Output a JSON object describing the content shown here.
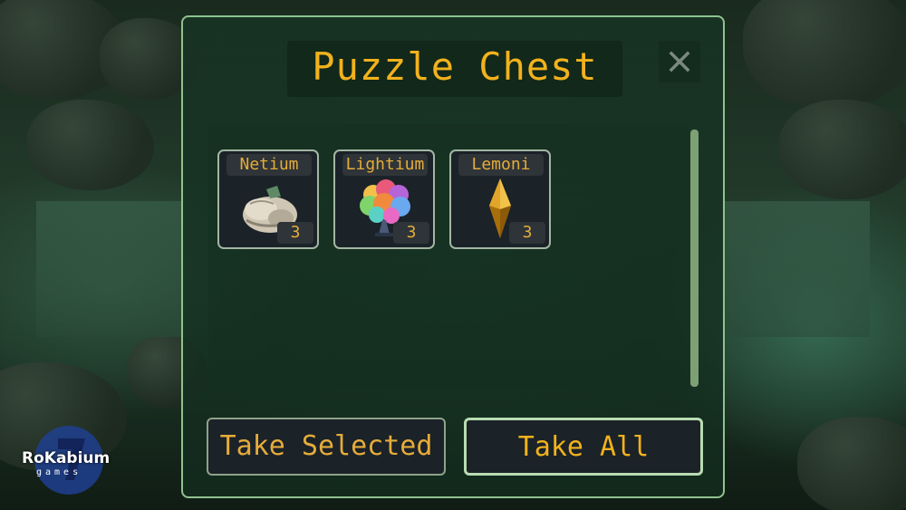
{
  "window": {
    "title": "Puzzle Chest",
    "close_label": "X"
  },
  "items": [
    {
      "name": "Netium",
      "quantity": "3",
      "icon": "netium-ore-icon"
    },
    {
      "name": "Lightium",
      "quantity": "3",
      "icon": "lightium-crystal-icon"
    },
    {
      "name": "Lemoni",
      "quantity": "3",
      "icon": "lemoni-gem-icon"
    }
  ],
  "actions": {
    "take_selected": "Take Selected",
    "take_all": "Take All"
  },
  "branding": {
    "logo_text": "RoKabium",
    "logo_subtext": "games"
  },
  "colors": {
    "accent": "#f2b21c",
    "label": "#e5ac3a",
    "panel_border": "#8fc28f",
    "slot_bg": "#1b2228"
  }
}
